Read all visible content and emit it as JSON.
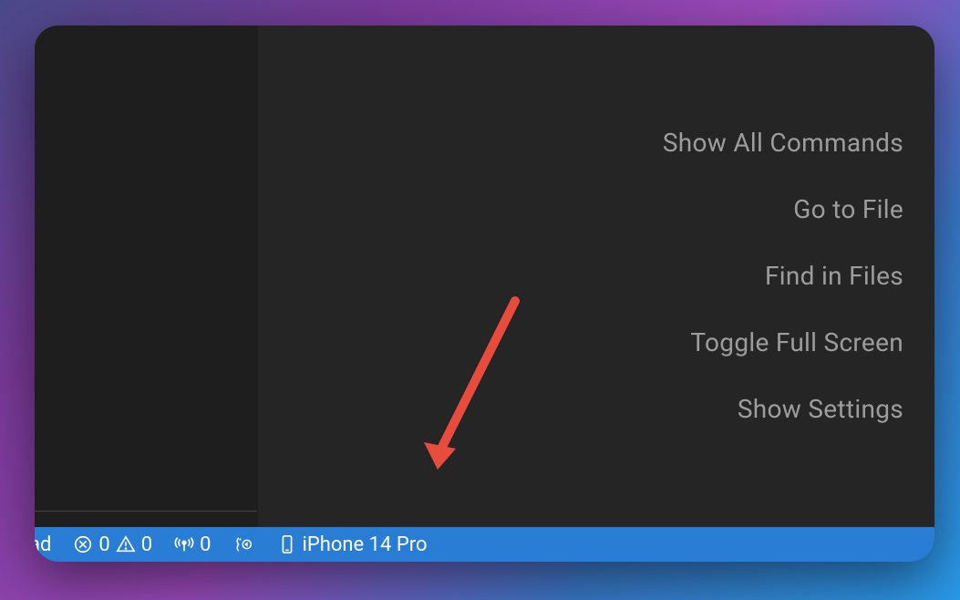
{
  "welcome": {
    "commands": [
      "Show All Commands",
      "Go to File",
      "Find in Files",
      "Toggle Full Screen",
      "Show Settings"
    ]
  },
  "statusBar": {
    "partialText": "ad",
    "errors": "0",
    "warnings": "0",
    "portForward": "0",
    "device": "iPhone 14 Pro"
  }
}
